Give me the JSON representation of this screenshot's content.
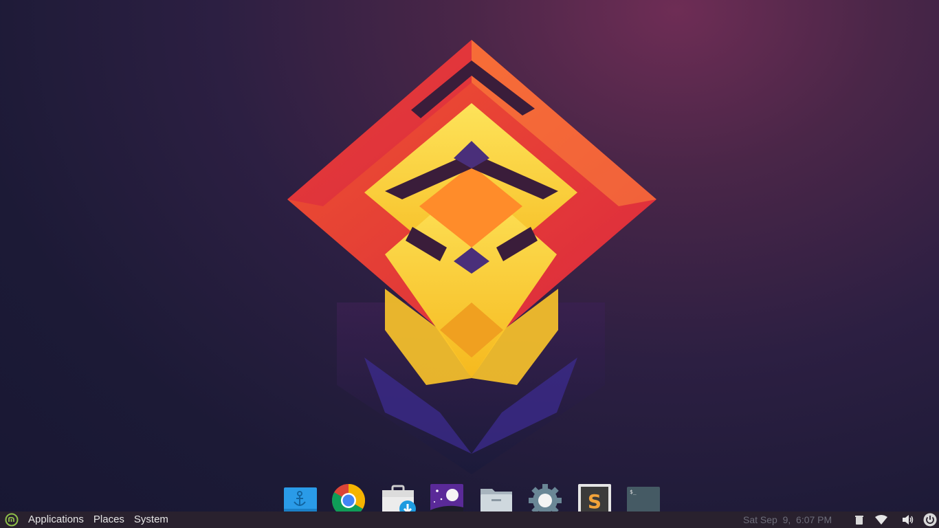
{
  "panel": {
    "menu_logo_icon": "mint-menu-icon",
    "menus": [
      {
        "label": "Applications"
      },
      {
        "label": "Places"
      },
      {
        "label": "System"
      }
    ],
    "clock": "Sat Sep  9,  6:07 PM",
    "tray_icons": [
      "trash-icon",
      "wifi-icon",
      "volume-icon",
      "power-icon"
    ]
  },
  "dock": {
    "items": [
      {
        "name": "dock-anchor-app",
        "icon": "anchor-icon",
        "color": "#2a9be8"
      },
      {
        "name": "google-chrome",
        "icon": "chrome-icon",
        "color": "#4285f4"
      },
      {
        "name": "software-downloads",
        "icon": "briefcase-download-icon",
        "color": "#e8e8e8"
      },
      {
        "name": "night-sky-app",
        "icon": "moon-stars-icon",
        "color": "#5a2a98"
      },
      {
        "name": "files",
        "icon": "folder-icon",
        "color": "#c8d0d8"
      },
      {
        "name": "settings",
        "icon": "gear-icon",
        "color": "#6a8796"
      },
      {
        "name": "sublime-text",
        "icon": "sublime-icon",
        "color": "#f2a33a"
      },
      {
        "name": "terminal",
        "icon": "terminal-icon",
        "color": "#455a64"
      }
    ]
  },
  "colors": {
    "panel_bg": "#29212e",
    "wallpaper_accent_red": "#f23b3b",
    "wallpaper_accent_yellow": "#fcd12a",
    "wallpaper_accent_orange": "#ff7a2b"
  }
}
